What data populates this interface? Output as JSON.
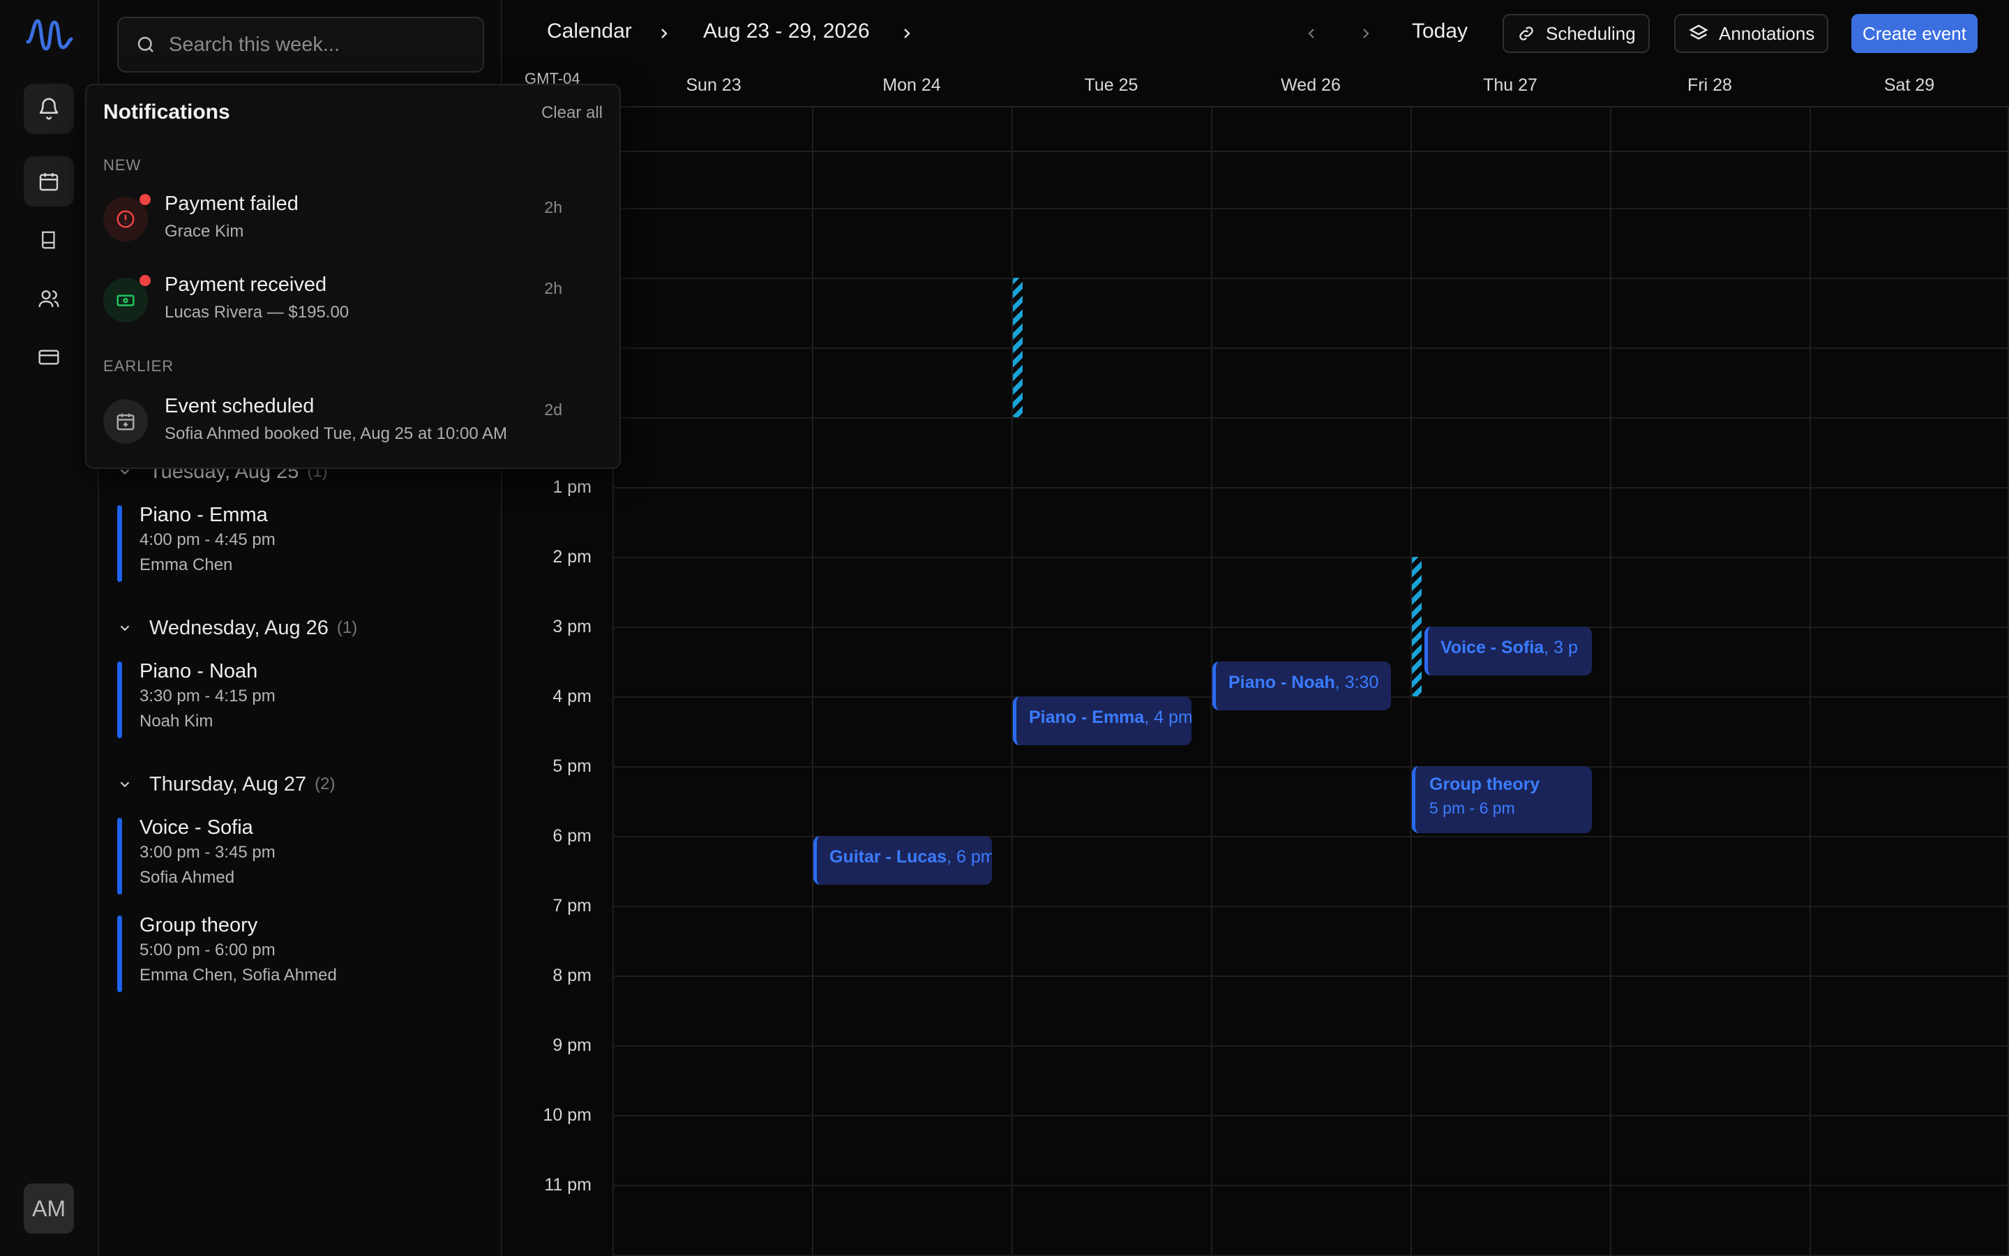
{
  "rail": {
    "avatar_initials": "AM"
  },
  "agenda": {
    "search_placeholder": "Search this week...",
    "groups": [
      {
        "heading": "Tuesday, Aug 25",
        "count": "(1)",
        "events": [
          {
            "title": "Piano - Emma",
            "time": "4:00 pm - 4:45 pm",
            "people": "Emma Chen"
          }
        ]
      },
      {
        "heading": "Wednesday, Aug 26",
        "count": "(1)",
        "events": [
          {
            "title": "Piano - Noah",
            "time": "3:30 pm - 4:15 pm",
            "people": "Noah Kim"
          }
        ]
      },
      {
        "heading": "Thursday, Aug 27",
        "count": "(2)",
        "events": [
          {
            "title": "Voice - Sofia",
            "time": "3:00 pm - 3:45 pm",
            "people": "Sofia Ahmed"
          },
          {
            "title": "Group theory",
            "time": "5:00 pm - 6:00 pm",
            "people": "Emma Chen, Sofia Ahmed"
          }
        ]
      }
    ]
  },
  "header": {
    "section": "Calendar",
    "range": "Aug 23 - 29, 2026",
    "today_label": "Today",
    "scheduling_label": "Scheduling",
    "annotations_label": "Annotations",
    "create_label": "Create event"
  },
  "calendar": {
    "timezone": "GMT-04",
    "days": [
      "Sun 23",
      "Mon 24",
      "Tue 25",
      "Wed 26",
      "Thu 27",
      "Fri 28",
      "Sat 29"
    ],
    "hours": [
      "1 pm",
      "2 pm",
      "3 pm",
      "4 pm",
      "5 pm",
      "6 pm",
      "7 pm",
      "8 pm",
      "9 pm",
      "10 pm",
      "11 pm"
    ],
    "events": [
      {
        "title": "Guitar - Lucas",
        "time": "6 pm"
      },
      {
        "title": "Piano - Emma",
        "time": "4 pm"
      },
      {
        "title": "Piano - Noah",
        "time": "3:30"
      },
      {
        "title": "Voice - Sofia",
        "time": "3 p"
      },
      {
        "title": "Group theory",
        "time": "5 pm - 6 pm"
      }
    ]
  },
  "notifications": {
    "title": "Notifications",
    "clear_label": "Clear all",
    "new_label": "NEW",
    "earlier_label": "EARLIER",
    "items": [
      {
        "title": "Payment failed",
        "subtitle": "Grace Kim",
        "age": "2h",
        "unread": true,
        "icon": "alert-circle-icon",
        "color": "#ef4444"
      },
      {
        "title": "Payment received",
        "subtitle": "Lucas Rivera — $195.00",
        "age": "2h",
        "unread": true,
        "icon": "banknote-icon",
        "color": "#22c55e"
      },
      {
        "title": "Event scheduled",
        "subtitle": "Sofia Ahmed booked Tue, Aug 25 at 10:00 AM",
        "age": "2d",
        "unread": false,
        "icon": "calendar-plus-icon",
        "color": "#9a9a9a"
      }
    ]
  },
  "colors": {
    "accent": "#3b6fe0",
    "event_fill": "#1b2458",
    "event_text": "#3a7cff",
    "hatch": "#1aa3d9"
  }
}
